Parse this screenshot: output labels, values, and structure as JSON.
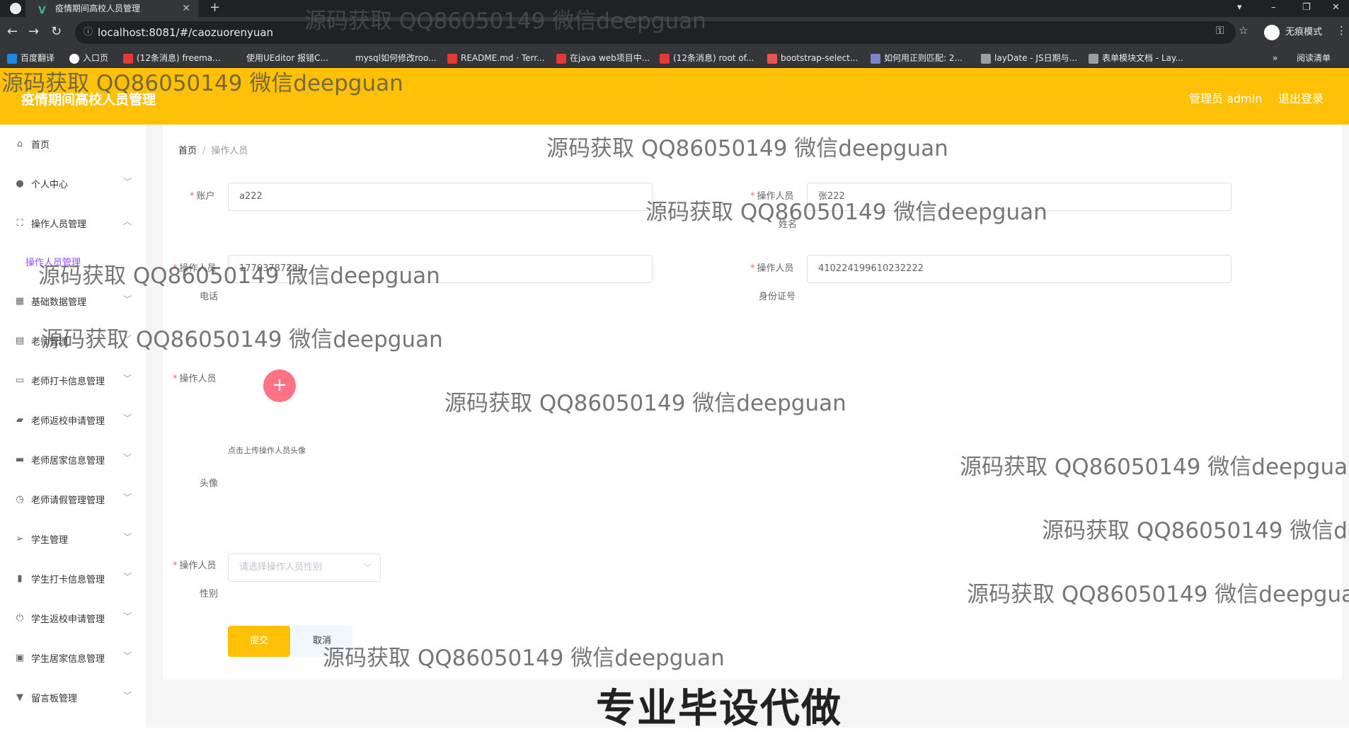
{
  "browser": {
    "tab_title": "疫情期间高校人员管理",
    "url": "localhost:8081/#/caozuorenyuan",
    "incognito_label": "无痕模式",
    "reading_list": "阅读清单",
    "bookmarks": [
      "百度翻译",
      "入口页",
      "(12条消息) freema...",
      "使用UEditor 报错C...",
      "mysql如何修改roo...",
      "README.md · Terr...",
      "在java web项目中...",
      "(12条消息) root of...",
      "bootstrap-select...",
      "如何用正则匹配: 2...",
      "layDate - JS日期与...",
      "表单模块文档 - Lay..."
    ]
  },
  "header": {
    "title": "疫情期间高校人员管理",
    "admin": "管理员 admin",
    "logout": "退出登录",
    "color": "#ffc107"
  },
  "sidebar": {
    "items": [
      {
        "label": "首页",
        "icon": "home-icon"
      },
      {
        "label": "个人中心",
        "icon": "user-icon"
      },
      {
        "label": "操作人员管理",
        "icon": "frame-icon"
      },
      {
        "label": "操作人员管理",
        "icon": ""
      },
      {
        "label": "基础数据管理",
        "icon": "grid-icon"
      },
      {
        "label": "老师管理",
        "icon": "table-icon"
      },
      {
        "label": "老师打卡信息管理",
        "icon": "message-icon"
      },
      {
        "label": "老师返校申请管理",
        "icon": "school-icon"
      },
      {
        "label": "老师居家信息管理",
        "icon": "briefcase-icon"
      },
      {
        "label": "老师请假管理管理",
        "icon": "clock-icon"
      },
      {
        "label": "学生管理",
        "icon": "send-icon"
      },
      {
        "label": "学生打卡信息管理",
        "icon": "bar-chart-icon"
      },
      {
        "label": "学生返校申请管理",
        "icon": "power-icon"
      },
      {
        "label": "学生居家信息管理",
        "icon": "clipboard-icon"
      },
      {
        "label": "留言板管理",
        "icon": "pin-icon"
      }
    ]
  },
  "breadcrumb": {
    "home": "首页",
    "current": "操作人员"
  },
  "form": {
    "account_label": "账户",
    "account_value": "a222",
    "name_label_1": "操作人员",
    "name_label_2": "姓名",
    "name_value": "张222",
    "phone_label_1": "操作人员",
    "phone_label_2": "电话",
    "phone_value": "17703787222",
    "idcard_label_1": "操作人员",
    "idcard_label_2": "身份证号",
    "idcard_value": "410224199610232222",
    "avatar_label_1": "操作人员",
    "avatar_label_2": "头像",
    "upload_tip": "点击上传操作人员头像",
    "gender_label_1": "操作人员",
    "gender_label_2": "性别",
    "gender_placeholder": "请选择操作人员性别",
    "submit": "提交",
    "cancel": "取消"
  },
  "watermark": "源码获取 QQ86050149 微信deepguan",
  "caption": "专业毕设代做"
}
